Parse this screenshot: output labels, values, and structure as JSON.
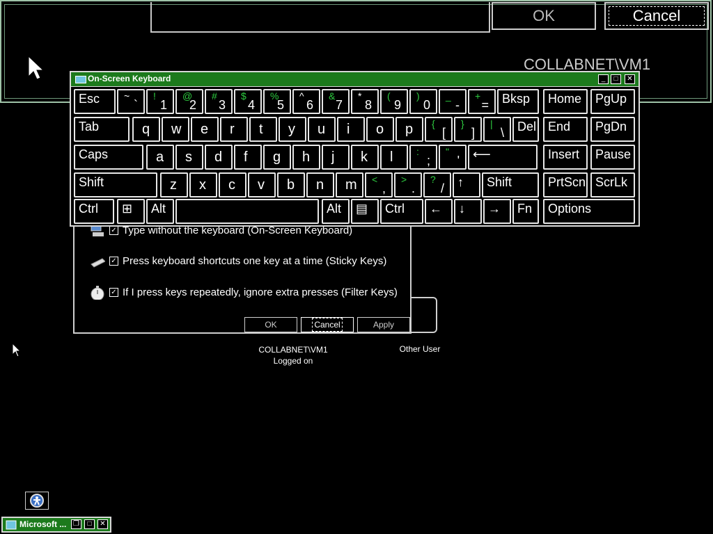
{
  "top_dialog": {
    "ok_label": "OK",
    "cancel_label": "Cancel",
    "user_label": "COLLABNET\\VM1"
  },
  "accessibility_dialog": {
    "options": [
      {
        "label": "Type without the keyboard (On-Screen Keyboard)",
        "checked": true,
        "icon": "keyboard-monitor-icon"
      },
      {
        "label": "Press keyboard shortcuts one key at a time (Sticky Keys)",
        "checked": true,
        "icon": "sticky-keys-icon"
      },
      {
        "label": "If I press keys repeatedly, ignore extra presses (Filter Keys)",
        "checked": true,
        "icon": "stopwatch-icon"
      }
    ],
    "ok_label": "OK",
    "cancel_label": "Cancel",
    "apply_label": "Apply"
  },
  "user_tiles": {
    "user1_name": "COLLABNET\\VM1",
    "user1_status": "Logged on",
    "other_user": "Other User"
  },
  "osk": {
    "title": "On-Screen Keyboard",
    "rows": [
      [
        {
          "id": "esc",
          "label": "Esc"
        },
        {
          "id": "backtick",
          "shift": "~",
          "base": "`"
        },
        {
          "id": "1",
          "shift": "!",
          "base": "1"
        },
        {
          "id": "2",
          "shift": "@",
          "base": "2"
        },
        {
          "id": "3",
          "shift": "#",
          "base": "3"
        },
        {
          "id": "4",
          "shift": "$",
          "base": "4"
        },
        {
          "id": "5",
          "shift": "%",
          "base": "5"
        },
        {
          "id": "6",
          "shift": "^",
          "base": "6"
        },
        {
          "id": "7",
          "shift": "&",
          "base": "7"
        },
        {
          "id": "8",
          "shift": "*",
          "base": "8"
        },
        {
          "id": "9",
          "shift": "(",
          "base": "9"
        },
        {
          "id": "0",
          "shift": ")",
          "base": "0"
        },
        {
          "id": "minus",
          "shift": "_",
          "base": "-"
        },
        {
          "id": "equals",
          "shift": "+",
          "base": "="
        },
        {
          "id": "bksp",
          "label": "Bksp"
        },
        {
          "id": "home",
          "label": "Home"
        },
        {
          "id": "pgup",
          "label": "PgUp"
        }
      ],
      [
        {
          "id": "tab",
          "label": "Tab"
        },
        {
          "id": "q",
          "single": "q"
        },
        {
          "id": "w",
          "single": "w"
        },
        {
          "id": "e",
          "single": "e"
        },
        {
          "id": "r",
          "single": "r"
        },
        {
          "id": "t",
          "single": "t"
        },
        {
          "id": "y",
          "single": "y"
        },
        {
          "id": "u",
          "single": "u"
        },
        {
          "id": "i",
          "single": "i"
        },
        {
          "id": "o",
          "single": "o"
        },
        {
          "id": "p",
          "single": "p"
        },
        {
          "id": "lbracket",
          "shift": "{",
          "base": "["
        },
        {
          "id": "rbracket",
          "shift": "}",
          "base": "]"
        },
        {
          "id": "backslash",
          "shift": "|",
          "base": "\\"
        },
        {
          "id": "del",
          "label": "Del"
        },
        {
          "id": "end",
          "label": "End"
        },
        {
          "id": "pgdn",
          "label": "PgDn"
        }
      ],
      [
        {
          "id": "caps",
          "label": "Caps"
        },
        {
          "id": "a",
          "single": "a"
        },
        {
          "id": "s",
          "single": "s"
        },
        {
          "id": "d",
          "single": "d"
        },
        {
          "id": "f",
          "single": "f"
        },
        {
          "id": "g",
          "single": "g"
        },
        {
          "id": "h",
          "single": "h"
        },
        {
          "id": "j",
          "single": "j"
        },
        {
          "id": "k",
          "single": "k"
        },
        {
          "id": "l",
          "single": "l"
        },
        {
          "id": "semicolon",
          "shift": ":",
          "base": ";"
        },
        {
          "id": "quote",
          "shift": "\"",
          "base": "'"
        },
        {
          "id": "enter",
          "label": "⟵"
        },
        {
          "id": "insert",
          "label": "Insert"
        },
        {
          "id": "pause",
          "label": "Pause"
        }
      ],
      [
        {
          "id": "lshift",
          "label": "Shift"
        },
        {
          "id": "z",
          "single": "z"
        },
        {
          "id": "x",
          "single": "x"
        },
        {
          "id": "c",
          "single": "c"
        },
        {
          "id": "v",
          "single": "v"
        },
        {
          "id": "b",
          "single": "b"
        },
        {
          "id": "n",
          "single": "n"
        },
        {
          "id": "m",
          "single": "m"
        },
        {
          "id": "comma",
          "shift": "<",
          "base": ","
        },
        {
          "id": "period",
          "shift": ">",
          "base": "."
        },
        {
          "id": "slash",
          "shift": "?",
          "base": "/"
        },
        {
          "id": "up",
          "label": "↑"
        },
        {
          "id": "rshift",
          "label": "Shift"
        },
        {
          "id": "prtscn",
          "label": "PrtScn"
        },
        {
          "id": "scrlk",
          "label": "ScrLk"
        }
      ],
      [
        {
          "id": "lctrl",
          "label": "Ctrl"
        },
        {
          "id": "win",
          "label": "⊞"
        },
        {
          "id": "lalt",
          "label": "Alt"
        },
        {
          "id": "space",
          "label": ""
        },
        {
          "id": "ralt",
          "label": "Alt"
        },
        {
          "id": "menu",
          "label": "▤"
        },
        {
          "id": "rctrl",
          "label": "Ctrl"
        },
        {
          "id": "left",
          "label": "←"
        },
        {
          "id": "down",
          "label": "↓"
        },
        {
          "id": "right",
          "label": "→"
        },
        {
          "id": "fn",
          "label": "Fn"
        },
        {
          "id": "options",
          "label": "Options"
        }
      ]
    ]
  },
  "taskbar": {
    "button_label": "Microsoft ..."
  }
}
